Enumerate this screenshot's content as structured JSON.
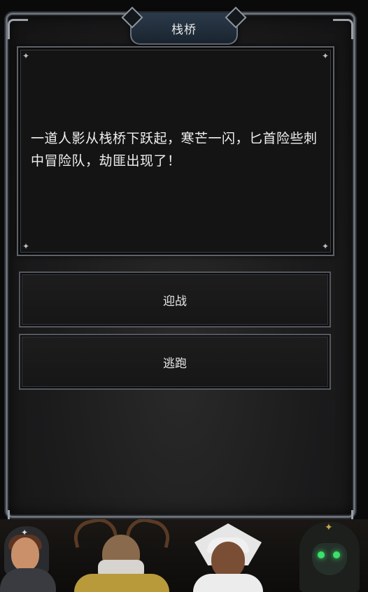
{
  "event": {
    "title": "栈桥",
    "text": "一道人影从栈桥下跃起，寒芒一闪，匕首险些刺中冒险队，劫匪出现了！"
  },
  "choices": [
    {
      "label": "迎战"
    },
    {
      "label": "逃跑"
    }
  ],
  "party": [
    {
      "name": "hooded-woman-portrait"
    },
    {
      "name": "antlered-druid-portrait"
    },
    {
      "name": "priestess-portrait"
    },
    {
      "name": "plague-mask-portrait"
    }
  ],
  "icons": {
    "corner_star": "✦"
  }
}
